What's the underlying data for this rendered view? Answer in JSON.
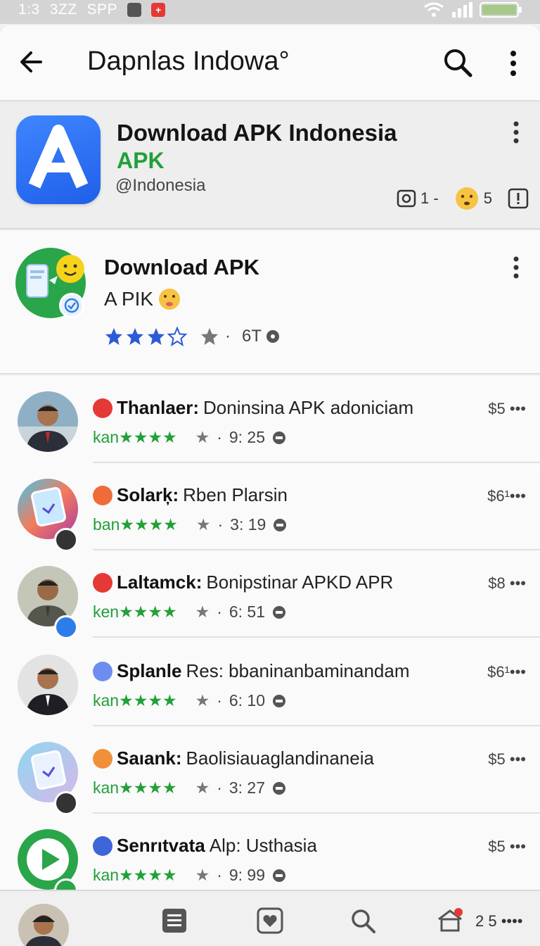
{
  "status_bar": {
    "time": "1:3",
    "left_text_1": "3ZZ",
    "left_text_2": "SPP"
  },
  "app_bar": {
    "title": "Dapnlas Indowa°"
  },
  "header_card": {
    "title": "Download APK Indonesia",
    "subtitle": "APK",
    "handle": "@Indonesia",
    "stat_1": "1 -",
    "stat_2": "5"
  },
  "featured": {
    "title": "Download APK",
    "subtitle": "A PIK",
    "rating_count": "6T",
    "stars_filled": 3
  },
  "rows": [
    {
      "name": "Thanlaer:",
      "desc": "Doninsina APK adoniciam",
      "tag": "kan★★★★",
      "time": "9: 25",
      "price": "$5 •••",
      "dot_color": "#e53935",
      "avatar_bg": "#c9d4da",
      "badge": ""
    },
    {
      "name": "Solarķ:",
      "desc": "Rben Plarsin",
      "tag": "ban★★★★",
      "time": "3: 19",
      "price": "$6¹•••",
      "dot_color": "#ef6c3a",
      "avatar_bg": "#f47b5a",
      "badge": "#333"
    },
    {
      "name": "Laltamck:",
      "desc": "Bonipstinar APKD APR",
      "tag": "ken★★★★",
      "time": "6: 51",
      "price": "$8 •••",
      "dot_color": "#e53935",
      "avatar_bg": "#b8bcb0",
      "badge": "#2d7de8"
    },
    {
      "name": "Splanle",
      "desc": "Res: bbaninanbaminandam",
      "tag": "kan★★★★",
      "time": "6: 10",
      "price": "$6¹•••",
      "dot_color": "#6d8ef0",
      "avatar_bg": "#dcdcdc",
      "badge": ""
    },
    {
      "name": "Saıank:",
      "desc": "Baolisiauaglandinaneia",
      "tag": "kan★★★★",
      "time": "3: 27",
      "price": "$5 •••",
      "dot_color": "#f0913a",
      "avatar_bg": "#d6b8e8",
      "badge": "#333"
    },
    {
      "name": "Senrıtvata",
      "desc": "Alp: Usthasia",
      "tag": "kan★★★★",
      "time": "9: 99",
      "price": "$5 •••",
      "dot_color": "#3e66d8",
      "avatar_bg": "#2aa54a",
      "badge": "#2aa54a"
    }
  ],
  "bottom_nav": {
    "label": "2 5 ••••"
  },
  "colors": {
    "accent_green": "#21a038",
    "app_blue": "#2f6ff0",
    "star_blue": "#2d5bd8"
  }
}
